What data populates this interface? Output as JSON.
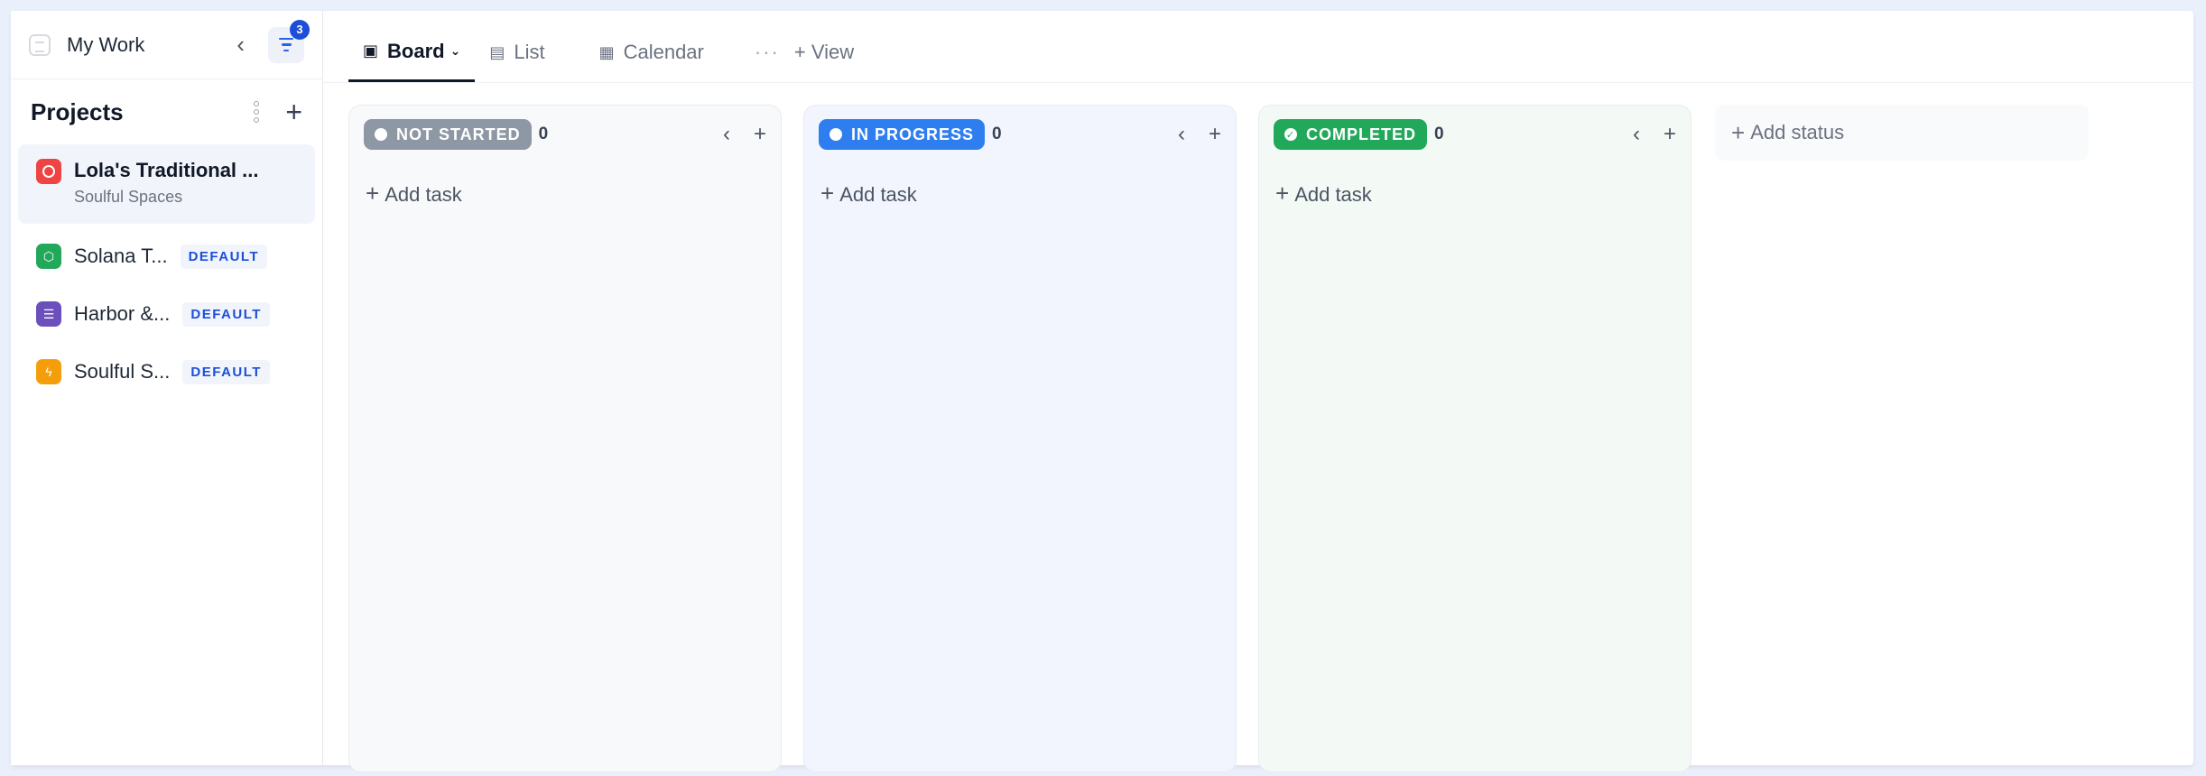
{
  "sidebar": {
    "title": "My Work",
    "filter_count": "3",
    "projects_heading": "Projects",
    "projects": [
      {
        "name": "Lola's Traditional ...",
        "subtitle": "Soulful Spaces",
        "color": "#ef4444",
        "icon": "circle-icon"
      },
      {
        "name": "Solana T...",
        "badge": "DEFAULT",
        "color": "#22a85a",
        "icon": "hexagon-icon"
      },
      {
        "name": "Harbor &...",
        "badge": "DEFAULT",
        "color": "#6b4fbb",
        "icon": "list-icon"
      },
      {
        "name": "Soulful S...",
        "badge": "DEFAULT",
        "color": "#f59e0b",
        "icon": "bolt-icon"
      }
    ]
  },
  "tabs": {
    "board": "Board",
    "list": "List",
    "calendar": "Calendar",
    "more": "···",
    "add_view": "+ View"
  },
  "columns": [
    {
      "status": "NOT STARTED",
      "count": "0",
      "pill_color": "#8e97a4",
      "bg_color": "#f8f9fb",
      "add_label": "Add task"
    },
    {
      "status": "IN PROGRESS",
      "count": "0",
      "pill_color": "#2f7ef0",
      "bg_color": "#f2f5fd",
      "add_label": "Add task"
    },
    {
      "status": "COMPLETED",
      "count": "0",
      "pill_color": "#22a85a",
      "bg_color": "#f3f9f5",
      "add_label": "Add task"
    }
  ],
  "add_status_label": "Add status"
}
